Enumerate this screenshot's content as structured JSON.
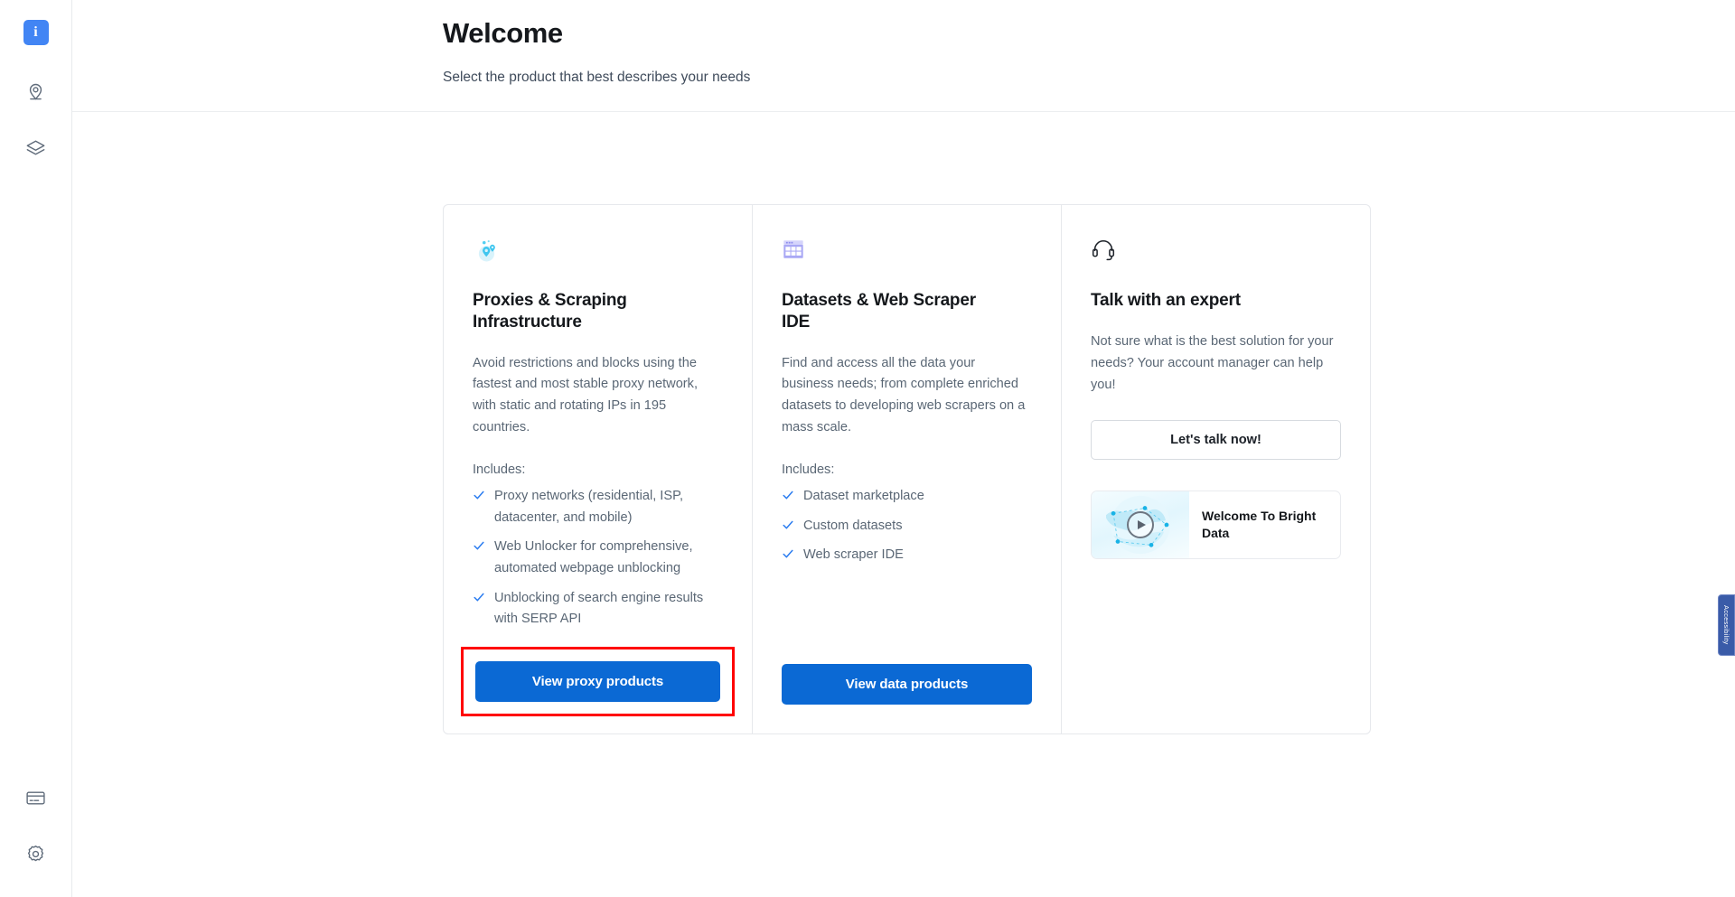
{
  "sidebar": {
    "top_items": [
      {
        "name": "info-badge",
        "icon": "info-icon",
        "label": "i"
      },
      {
        "name": "proxy-locations",
        "icon": "location-pin-icon",
        "label": ""
      },
      {
        "name": "datasets",
        "icon": "layers-icon",
        "label": ""
      }
    ],
    "bottom_items": [
      {
        "name": "billing",
        "icon": "credit-card-icon",
        "label": ""
      },
      {
        "name": "settings",
        "icon": "gear-icon",
        "label": ""
      }
    ]
  },
  "header": {
    "title": "Welcome",
    "subtitle": "Select the product that best describes your needs"
  },
  "cards": [
    {
      "icon": "globe-proxy-icon",
      "title": "Proxies & Scraping Infrastructure",
      "description": "Avoid restrictions and blocks using the fastest and most stable proxy network, with static and rotating IPs in 195 countries.",
      "includes_label": "Includes:",
      "includes": [
        "Proxy networks (residential, ISP, datacenter, and mobile)",
        "Web Unlocker for comprehensive, automated webpage unblocking",
        "Unblocking of search engine results with SERP API"
      ],
      "cta": "View proxy products",
      "highlighted": true
    },
    {
      "icon": "table-grid-icon",
      "title": "Datasets & Web Scraper IDE",
      "description": "Find and access all the data your business needs; from complete enriched datasets to developing web scrapers on a mass scale.",
      "includes_label": "Includes:",
      "includes": [
        "Dataset marketplace",
        "Custom datasets",
        "Web scraper IDE"
      ],
      "cta": "View data products",
      "highlighted": false
    },
    {
      "icon": "headset-icon",
      "title": "Talk with an expert",
      "description": "Not sure what is the best solution for your needs? Your account manager can help you!",
      "cta": "Let's talk now!",
      "video": {
        "icon": "play-icon",
        "thumbnail": "world-map-network-thumbnail",
        "title": "Welcome To Bright Data"
      },
      "highlighted": false
    }
  ],
  "accessibility_tab": {
    "label": "Accessibility"
  },
  "colors": {
    "primary_button": "#0b69d4",
    "highlight_outline": "#ff0000",
    "info_badge": "#4285f4",
    "check": "#2a7cf0",
    "proxy_icon": "#3fc6ef",
    "dataset_icon": "#a9a8f5",
    "accessibility_tab": "#3a5ba8"
  }
}
